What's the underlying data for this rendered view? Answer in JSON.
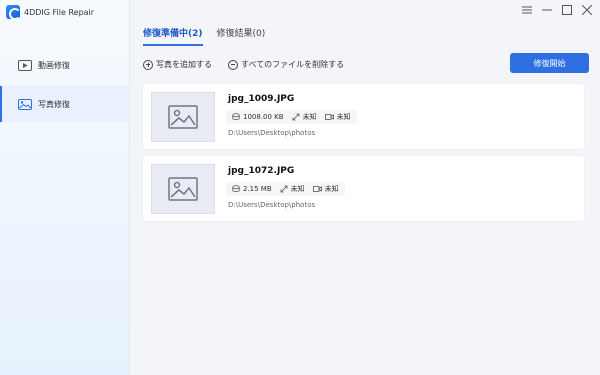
{
  "app": {
    "title": "4DDIG File Repair"
  },
  "sidebar": {
    "items": [
      {
        "label": "動画修復",
        "icon": "video-icon",
        "active": false
      },
      {
        "label": "写真修復",
        "icon": "photo-icon",
        "active": true
      }
    ]
  },
  "tabs": [
    {
      "label": "修復準備中(2)",
      "active": true
    },
    {
      "label": "修復結果(0)",
      "active": false
    }
  ],
  "actions": {
    "add_photos": "写真を追加する",
    "delete_all": "すべてのファイルを削除する",
    "start_repair": "修復開始"
  },
  "files": [
    {
      "name": "jpg_1009.JPG",
      "size": "1008.00 KB",
      "resolution": "未知",
      "duration": "未知",
      "path": "D:\\Users\\Desktop\\photos"
    },
    {
      "name": "jpg_1072.JPG",
      "size": "2.15 MB",
      "resolution": "未知",
      "duration": "未知",
      "path": "D:\\Users\\Desktop\\photos"
    }
  ],
  "colors": {
    "accent": "#2f6fe4",
    "sidebar_active": "#e8f1fd"
  }
}
